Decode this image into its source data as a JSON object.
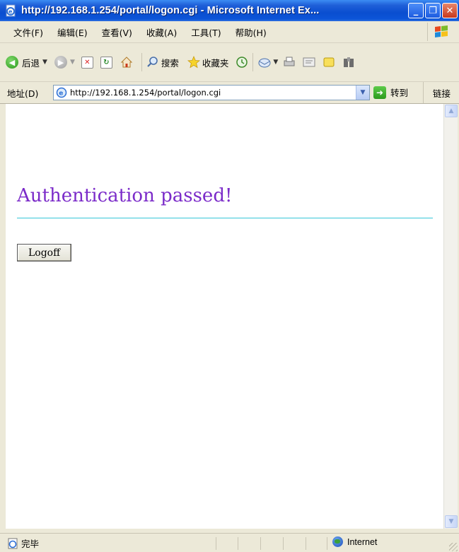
{
  "window": {
    "title": "http://192.168.1.254/portal/logon.cgi - Microsoft Internet Ex...",
    "controls": {
      "minimize": "_",
      "restore": "❐",
      "close": "✕"
    }
  },
  "menu": {
    "items": [
      "文件(F)",
      "编辑(E)",
      "查看(V)",
      "收藏(A)",
      "工具(T)",
      "帮助(H)"
    ]
  },
  "toolbar": {
    "back_label": "后退",
    "search_label": "搜索",
    "favorites_label": "收藏夹"
  },
  "address": {
    "label": "地址(D)",
    "url": "http://192.168.1.254/portal/logon.cgi",
    "go_label": "转到",
    "links_label": "链接"
  },
  "page": {
    "heading": "Authentication passed!",
    "logoff_label": "Logoff"
  },
  "status": {
    "text": "完毕",
    "zone": "Internet"
  },
  "colors": {
    "heading": "#7B2BC9",
    "rule": "#36C6D8",
    "titlebar": "#0A4ED0"
  }
}
